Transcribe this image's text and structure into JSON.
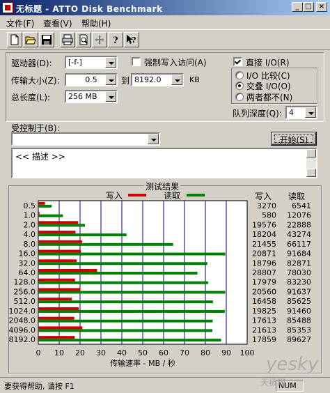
{
  "window": {
    "title": "无标题 - ATTO Disk Benchmark"
  },
  "menu": [
    {
      "label": "文件(F)"
    },
    {
      "label": "查看(V)"
    },
    {
      "label": "帮助(H)"
    }
  ],
  "toolbar": {
    "icons": [
      "new-file-icon",
      "open-folder-icon",
      "save-icon",
      "print-icon",
      "print-preview-icon",
      "move-icon",
      "help-icon",
      "context-help-icon"
    ]
  },
  "form": {
    "drive_label": "驱动器(D):",
    "drive_value": "[-f-]",
    "force_write_label": "强制写入访问(A)",
    "transfer_size_label": "传输大小(Z):",
    "transfer_from": "0.5",
    "to_label": "到",
    "transfer_to": "8192.0",
    "kb_label": "KB",
    "total_length_label": "总长度(L):",
    "total_length_value": "256 MB",
    "direct_io_label": "直接 I/O(R)",
    "io_compare_label": "I/O 比较(C)",
    "overlapped_label": "交叠 I/O(O)",
    "neither_label": "两者都不(N)",
    "queue_depth_label": "队列深度(Q):",
    "queue_depth_value": "4",
    "controlled_by_label": "受控制于(B):",
    "controlled_by_value": "",
    "start_button": "开始(S)",
    "description": "<< 描述 >>"
  },
  "results": {
    "group_title": "测试结果",
    "legend_write": "写入",
    "legend_read": "读取",
    "col_write": "写入",
    "col_read": "读取"
  },
  "chart_data": {
    "type": "bar",
    "orientation": "horizontal",
    "categories": [
      "0.5",
      "1.0",
      "2.0",
      "4.0",
      "8.0",
      "16.0",
      "32.0",
      "64.0",
      "128.0",
      "256.0",
      "512.0",
      "1024.0",
      "2048.0",
      "4096.0",
      "8192.0"
    ],
    "series": [
      {
        "name": "写入",
        "color": "#cc0000",
        "values": [
          3270,
          580,
          19576,
          18204,
          21455,
          20871,
          18796,
          28807,
          17979,
          20560,
          16458,
          19825,
          17613,
          21613,
          17859
        ]
      },
      {
        "name": "读取",
        "color": "#008000",
        "values": [
          6541,
          12076,
          22888,
          43274,
          66117,
          91684,
          82871,
          78030,
          83230,
          91637,
          85625,
          91460,
          85488,
          85353,
          89627
        ]
      }
    ],
    "x_ticks": [
      "0",
      "10",
      "20",
      "30",
      "40",
      "50",
      "60",
      "70",
      "80",
      "90",
      "100"
    ],
    "xlabel": "传输速率 - MB / 秒",
    "xlim": [
      0,
      100
    ],
    "value_unit": "KB/s",
    "grid": true
  },
  "status": {
    "help_text": "要获得帮助, 请按 F1",
    "num_indicator": "NUM"
  },
  "watermark": {
    "text": "yesky",
    "subtext": "天极网"
  },
  "colors": {
    "title_start": "#0a246a",
    "title_end": "#a6caf0",
    "face": "#d4d0c8",
    "write": "#cc0000",
    "read": "#008000",
    "grid": "#000080"
  }
}
